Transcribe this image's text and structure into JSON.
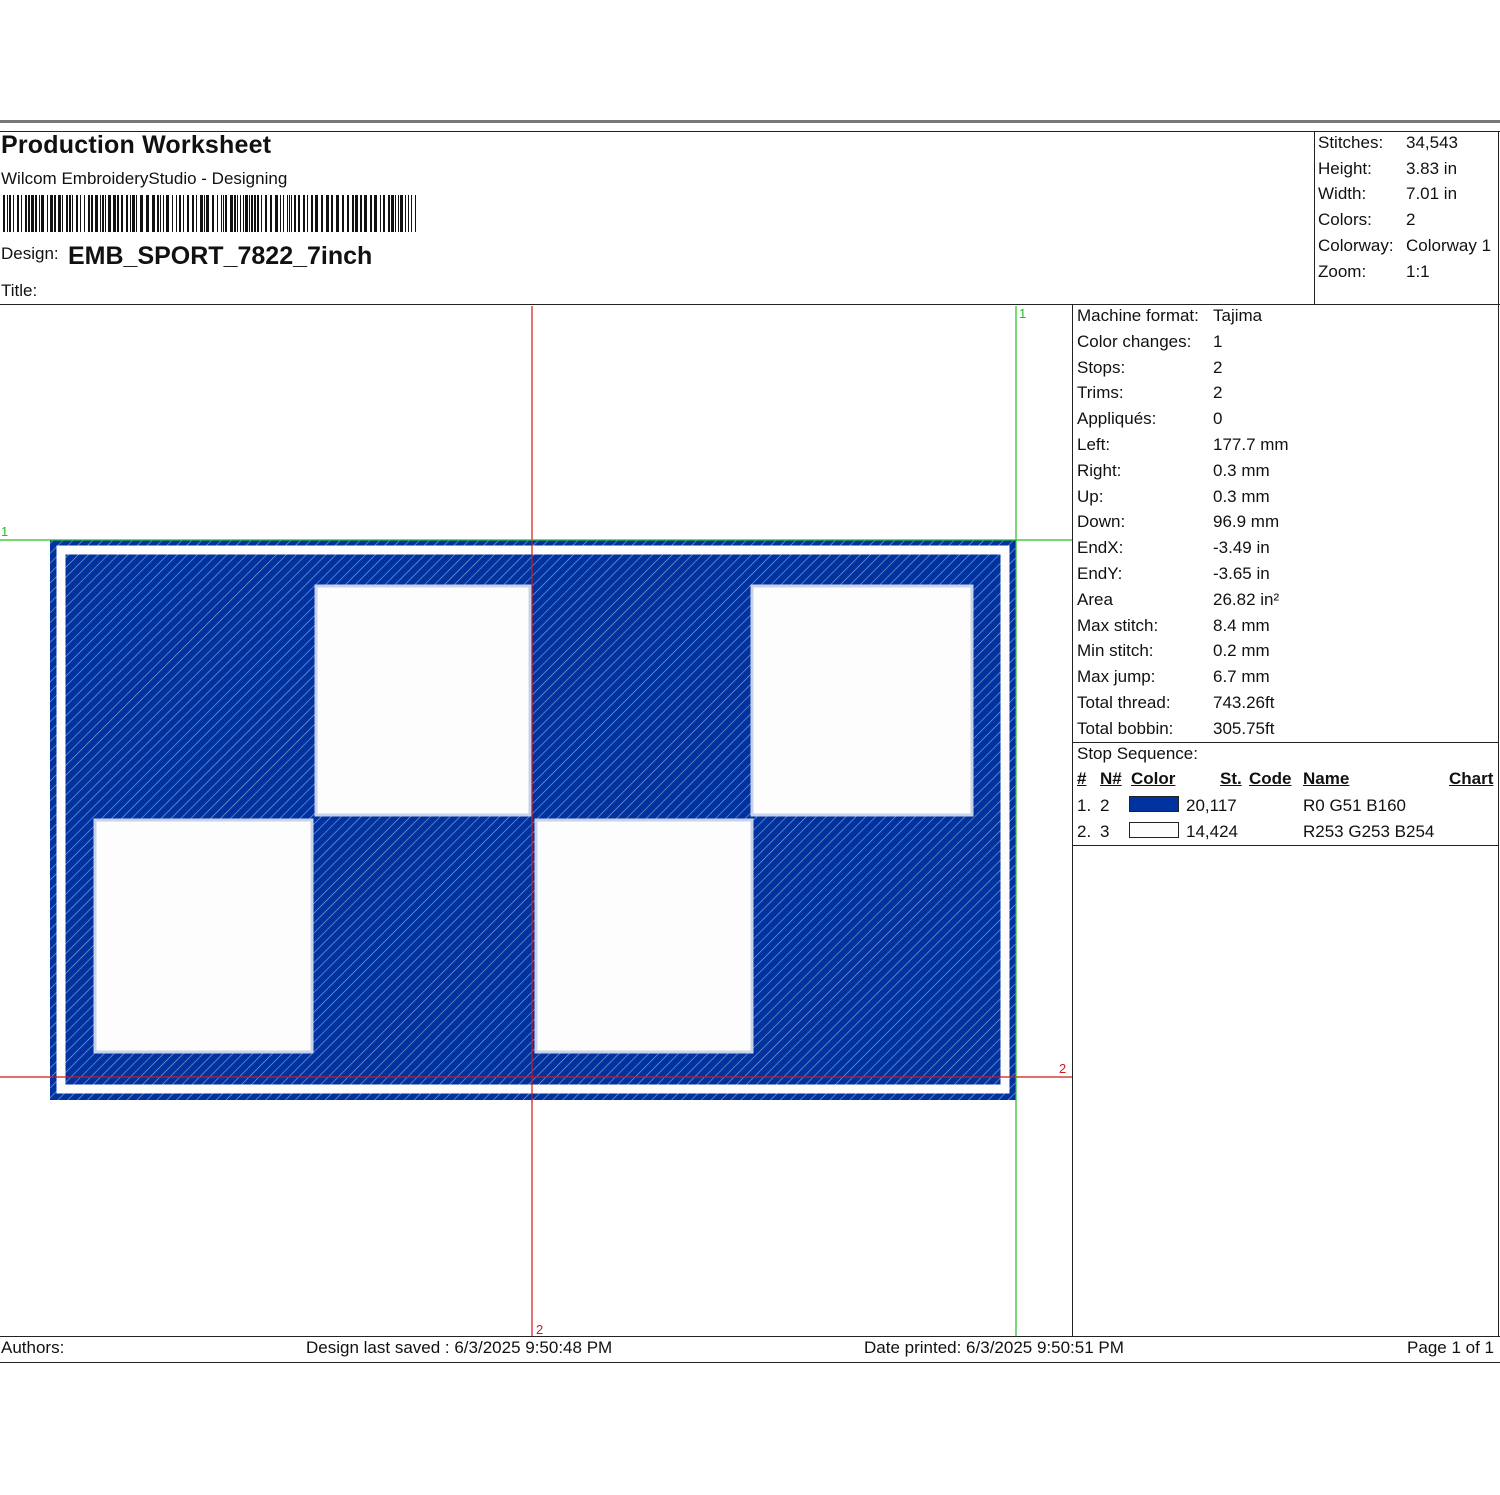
{
  "header": {
    "title": "Production Worksheet",
    "software": "Wilcom EmbroideryStudio - Designing",
    "design_label": "Design:",
    "design_name": "EMB_SPORT_7822_7inch",
    "title_label": "Title:"
  },
  "summary": [
    {
      "label": "Stitches:",
      "value": "34,543"
    },
    {
      "label": "Height:",
      "value": "3.83 in"
    },
    {
      "label": "Width:",
      "value": "7.01 in"
    },
    {
      "label": "Colors:",
      "value": "2"
    },
    {
      "label": "Colorway:",
      "value": "Colorway 1"
    },
    {
      "label": "Zoom:",
      "value": "1:1"
    }
  ],
  "details": [
    {
      "label": "Machine format:",
      "value": "Tajima"
    },
    {
      "label": "Color changes:",
      "value": "1"
    },
    {
      "label": "Stops:",
      "value": "2"
    },
    {
      "label": "Trims:",
      "value": "2"
    },
    {
      "label": "Appliqués:",
      "value": "0"
    },
    {
      "label": "Left:",
      "value": "177.7 mm"
    },
    {
      "label": "Right:",
      "value": "0.3 mm"
    },
    {
      "label": "Up:",
      "value": "0.3 mm"
    },
    {
      "label": "Down:",
      "value": "96.9 mm"
    },
    {
      "label": "EndX:",
      "value": "-3.49 in"
    },
    {
      "label": "EndY:",
      "value": "-3.65 in"
    },
    {
      "label": "Area",
      "value": " 26.82 in²"
    },
    {
      "label": "Max stitch:",
      "value": "8.4 mm"
    },
    {
      "label": "Min stitch:",
      "value": "0.2 mm"
    },
    {
      "label": "Max jump:",
      "value": "6.7 mm"
    },
    {
      "label": "Total thread:",
      "value": "743.26ft"
    },
    {
      "label": "Total bobbin:",
      "value": "305.75ft"
    }
  ],
  "stop_sequence": {
    "title": "Stop Sequence:",
    "headers": {
      "num": "#",
      "needle": "N#",
      "color": "Color",
      "stitches": "St.",
      "code": "Code",
      "name": "Name",
      "chart": "Chart"
    },
    "rows": [
      {
        "num": "1.",
        "needle": "2",
        "swatch": "#0033A0",
        "stitches": "20,117",
        "name": "R0 G51 B160"
      },
      {
        "num": "2.",
        "needle": "3",
        "swatch": "#FDFDFE",
        "stitches": "14,424",
        "name": "R253 G253 B254"
      }
    ]
  },
  "design_preview": {
    "marker_labels": {
      "green_v": "1",
      "green_h": "1",
      "red_h": "2",
      "red_v": "2"
    },
    "colors": {
      "fill": "#0033A0",
      "hatch": "#8FA8D8",
      "white": "#FDFDFE",
      "green": "#22C022",
      "red": "#D01818"
    },
    "checker": [
      [
        1,
        0,
        1,
        0
      ],
      [
        0,
        1,
        0,
        1
      ]
    ]
  },
  "footer": {
    "authors": "Authors:",
    "saved": "Design last saved : 6/3/2025 9:50:48 PM",
    "printed": "Date printed: 6/3/2025 9:50:51 PM",
    "page": "Page 1 of 1"
  }
}
